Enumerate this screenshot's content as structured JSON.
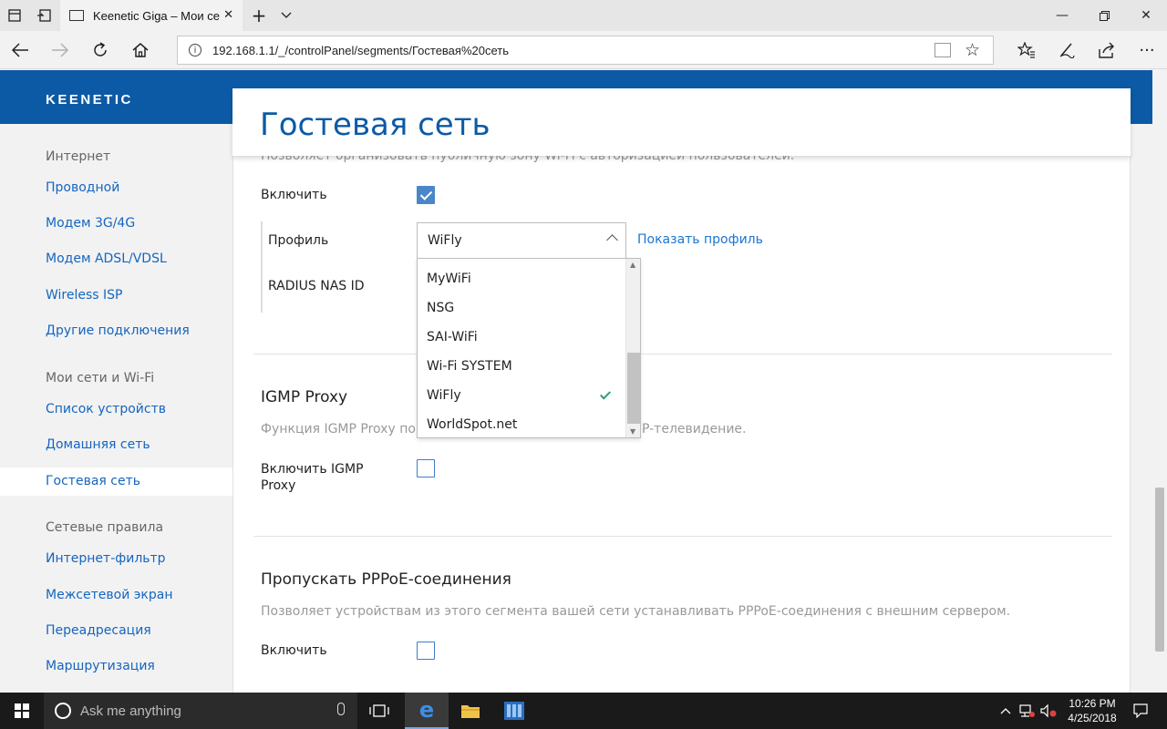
{
  "browser": {
    "tab_title": "Keenetic Giga – Мои се",
    "url": "192.168.1.1/_/controlPanel/segments/Гостевая%20сеть"
  },
  "brand": {
    "logo": "KEENETIC",
    "accent": "#0c5aa6"
  },
  "sidebar": {
    "groups": [
      {
        "heading": "Интернет",
        "items": [
          "Проводной",
          "Модем 3G/4G",
          "Модем ADSL/VDSL",
          "Wireless ISP",
          "Другие подключения"
        ]
      },
      {
        "heading": "Мои сети и Wi-Fi",
        "items": [
          "Список устройств",
          "Домашняя сеть",
          "Гостевая сеть"
        ]
      },
      {
        "heading": "Сетевые правила",
        "items": [
          "Интернет-фильтр",
          "Межсетевой экран",
          "Переадресация",
          "Маршрутизация"
        ]
      }
    ],
    "active_item": "Гостевая сеть"
  },
  "page": {
    "title": "Гостевая сеть",
    "hotspot": {
      "description": "Позволяет организовать публичную зону Wi-Fi с авторизацией пользователей.",
      "enable_label": "Включить",
      "enabled": true,
      "profile_label": "Профиль",
      "profile_value": "WiFly",
      "show_profile_link": "Показать профиль",
      "radius_label": "RADIUS NAS ID",
      "profile_options": [
        "MyWiFi",
        "NSG",
        "SAI-WiFi",
        "Wi-Fi SYSTEM",
        "WiFly",
        "WorldSpot.net"
      ],
      "selected_option": "WiFly"
    },
    "igmp": {
      "title": "IGMP Proxy",
      "description_start": "Функция IGMP Proxy по",
      "description_end": "P-телевидение.",
      "enable_label": "Включить IGMP Proxy",
      "enabled": false
    },
    "pppoe": {
      "title": "Пропускать PPPoE-соединения",
      "description": "Позволяет устройствам из этого сегмента вашей сети устанавливать PPPoE-соединения с внешним сервером.",
      "enable_label": "Включить",
      "enabled": false
    }
  },
  "taskbar": {
    "search_placeholder": "Ask me anything",
    "time": "10:26 PM",
    "date": "4/25/2018"
  }
}
